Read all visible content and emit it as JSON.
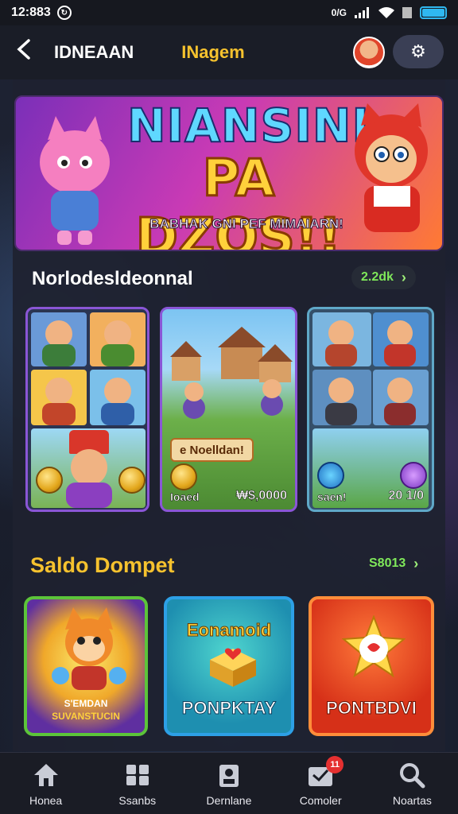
{
  "status_bar": {
    "time": "12:883",
    "right_text": "0/G"
  },
  "top_bar": {
    "back_icon": "chevron-left-icon",
    "app_title": "IDNEAAN",
    "page_label": "INagem",
    "settings_icon": "gear-icon"
  },
  "banner": {
    "line1": "NIANSINI",
    "line2": "PA DZOS!!",
    "subtitle": "BABHAK GNI PEF MIMAIARN!"
  },
  "section_games": {
    "title": "Norlodesldeonnal",
    "see_all": "2.2dk"
  },
  "games": {
    "card_b": {
      "pill": "e Noelldan!",
      "foot_left": "Ioaed",
      "foot_right": "₩$,0000"
    },
    "card_c": {
      "foot_left": "saen!",
      "foot_right": "20 1/0"
    }
  },
  "section_wallet": {
    "title": "Saldo Dompet",
    "see_all": "S8013"
  },
  "wallet": {
    "card1_line1": "S'EMDAN",
    "card1_line2": "SUVANSTUCIN",
    "card2_top": "Eonamoid",
    "card2_bottom": "PONPKTAY",
    "card3_bottom": "PONTBDVI"
  },
  "bottom_nav": {
    "items": [
      {
        "label": "Honea",
        "icon": "home-icon"
      },
      {
        "label": "Ssanbs",
        "icon": "grid-icon"
      },
      {
        "label": "Dernlane",
        "icon": "wallet-icon"
      },
      {
        "label": "Comoler",
        "icon": "inbox-icon",
        "badge": "11"
      },
      {
        "label": "Noartas",
        "icon": "search-icon"
      }
    ]
  },
  "colors": {
    "accent_yellow": "#f6c22e",
    "accent_green": "#7fe85a",
    "badge_red": "#e53030"
  }
}
